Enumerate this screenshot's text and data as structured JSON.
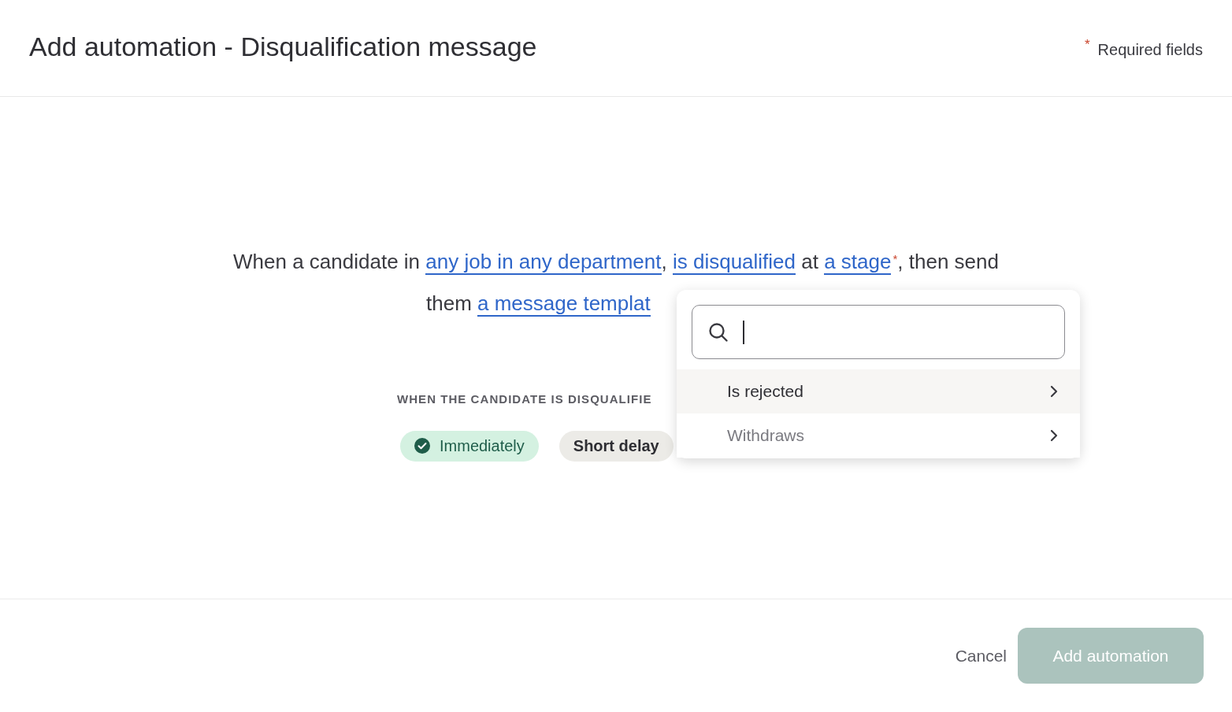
{
  "header": {
    "title": "Add automation - Disqualification message",
    "required_mark": "*",
    "required_label": "Required fields"
  },
  "sentence": [
    [
      {
        "kind": "text",
        "text": "When a candidate in "
      },
      {
        "kind": "link",
        "text": "any job in any department"
      },
      {
        "kind": "text",
        "text": ", "
      },
      {
        "kind": "link",
        "text": "is disqualified"
      },
      {
        "kind": "text",
        "text": " at "
      },
      {
        "kind": "link",
        "text": "a stage"
      },
      {
        "kind": "required",
        "text": "*"
      },
      {
        "kind": "text",
        "text": ", then send"
      }
    ],
    [
      {
        "kind": "text",
        "text": "them "
      },
      {
        "kind": "link",
        "text": "a message templat"
      }
    ]
  ],
  "timing": {
    "label": "WHEN THE CANDIDATE IS DISQUALIFIE",
    "options": [
      {
        "label": "Immediately",
        "selected": true
      },
      {
        "label": "Short delay",
        "selected": false
      }
    ]
  },
  "dropdown": {
    "items": [
      {
        "label": "Is rejected",
        "selected": true
      },
      {
        "label": "Withdraws",
        "selected": false
      }
    ]
  },
  "footer": {
    "cancel": "Cancel",
    "submit": {
      "label": "Add automation",
      "disabled": true
    }
  }
}
